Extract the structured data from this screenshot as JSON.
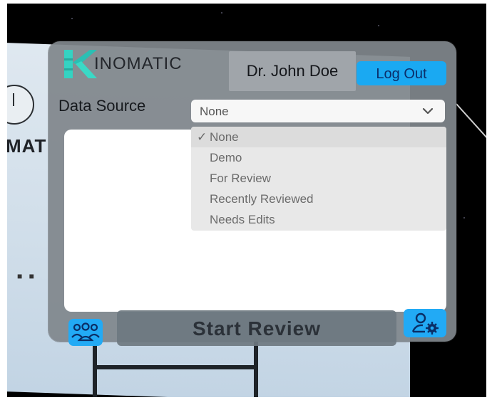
{
  "logo": {
    "text": "INOMATIC",
    "accent_color": "#34d3c2"
  },
  "header": {
    "user_name": "Dr. John Doe",
    "logout_label": "Log Out"
  },
  "data_source": {
    "label": "Data Source",
    "selected": "None",
    "options": [
      {
        "label": "None",
        "checked": true
      },
      {
        "label": "Demo",
        "checked": false
      },
      {
        "label": "For Review",
        "checked": false
      },
      {
        "label": "Recently Reviewed",
        "checked": false
      },
      {
        "label": "Needs Edits",
        "checked": false
      }
    ]
  },
  "footer": {
    "team_icon": "team-icon",
    "start_label": "Start Review",
    "settings_icon": "user-settings-icon"
  },
  "background": {
    "partial_text": "MAT"
  },
  "colors": {
    "panel": "#80868c",
    "accent_blue": "#1aa9f2"
  }
}
